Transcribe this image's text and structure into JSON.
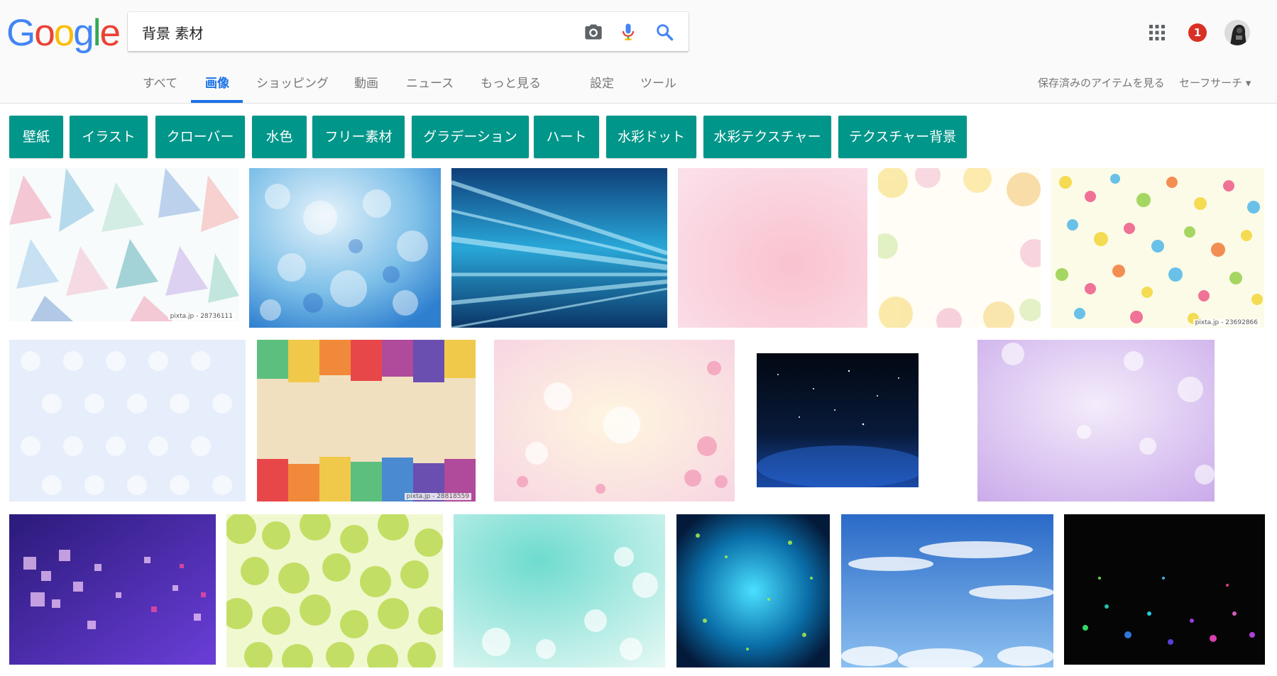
{
  "logo": {
    "letters": [
      "G",
      "o",
      "o",
      "g",
      "l",
      "e"
    ],
    "colors": [
      "#4285F4",
      "#EA4335",
      "#FBBC05",
      "#4285F4",
      "#34A853",
      "#EA4335"
    ]
  },
  "search": {
    "query": "背景 素材"
  },
  "header": {
    "notification_count": "1"
  },
  "tabs": [
    {
      "label": "すべて"
    },
    {
      "label": "画像"
    },
    {
      "label": "ショッピング"
    },
    {
      "label": "動画"
    },
    {
      "label": "ニュース"
    },
    {
      "label": "もっと見る"
    },
    {
      "label": "設定"
    },
    {
      "label": "ツール"
    }
  ],
  "right_links": {
    "saved": "保存済みのアイテムを見る",
    "safesearch": "セーフサーチ ▾"
  },
  "chips": [
    "壁紙",
    "イラスト",
    "クローバー",
    "水色",
    "フリー素材",
    "グラデーション",
    "ハート",
    "水彩ドット",
    "水彩テクスチャー",
    "テクスチャー背景"
  ],
  "accent_color": "#00968a",
  "results": [
    {
      "watermark": "pixta.jp - 28736111"
    },
    {
      "watermark": ""
    },
    {
      "watermark": ""
    },
    {
      "watermark": ""
    },
    {
      "watermark": ""
    },
    {
      "watermark": "pixta.jp - 23692866"
    },
    {
      "watermark": ""
    },
    {
      "watermark": "pixta.jp - 28818559"
    },
    {
      "watermark": ""
    },
    {
      "watermark": ""
    },
    {
      "watermark": ""
    },
    {
      "watermark": ""
    },
    {
      "watermark": ""
    },
    {
      "watermark": ""
    },
    {
      "watermark": ""
    },
    {
      "watermark": ""
    },
    {
      "watermark": ""
    }
  ]
}
